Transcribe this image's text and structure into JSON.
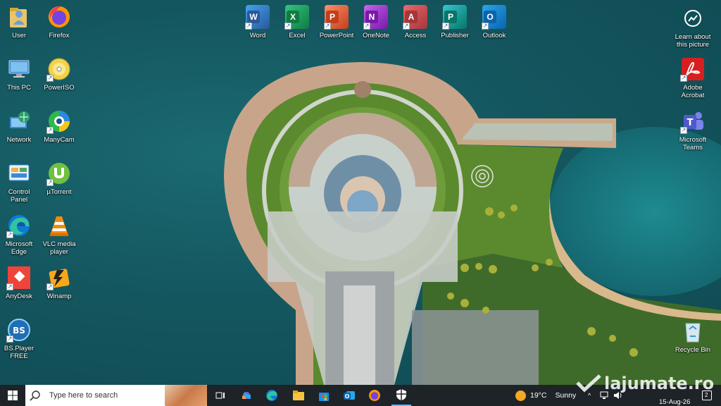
{
  "desktop": {
    "icons_left": [
      {
        "label": "User",
        "icon": "user-folder-icon"
      },
      {
        "label": "This PC",
        "icon": "this-pc-icon"
      },
      {
        "label": "Network",
        "icon": "network-icon"
      },
      {
        "label": "Control\nPanel",
        "icon": "control-panel-icon"
      },
      {
        "label": "Microsoft\nEdge",
        "icon": "edge-icon"
      },
      {
        "label": "AnyDesk",
        "icon": "anydesk-icon"
      },
      {
        "label": "BS.Player\nFREE",
        "icon": "bsplayer-icon"
      },
      {
        "label": "Firefox",
        "icon": "firefox-icon"
      },
      {
        "label": "PowerISO",
        "icon": "poweriso-icon"
      },
      {
        "label": "ManyCam",
        "icon": "manycam-icon"
      },
      {
        "label": "µTorrent",
        "icon": "utorrent-icon"
      },
      {
        "label": "VLC media\nplayer",
        "icon": "vlc-icon"
      },
      {
        "label": "Winamp",
        "icon": "winamp-icon"
      }
    ],
    "office_icons": [
      {
        "label": "Word",
        "letter": "W",
        "color": "#2b579a",
        "light": "#41a5ee"
      },
      {
        "label": "Excel",
        "letter": "X",
        "color": "#107c41",
        "light": "#33c481"
      },
      {
        "label": "PowerPoint",
        "letter": "P",
        "color": "#c43e1c",
        "light": "#ff8f6b"
      },
      {
        "label": "OneNote",
        "letter": "N",
        "color": "#7719aa",
        "light": "#ca64ea"
      },
      {
        "label": "Access",
        "letter": "A",
        "color": "#a4373a",
        "light": "#ee686b"
      },
      {
        "label": "Publisher",
        "letter": "P",
        "color": "#077568",
        "light": "#37c6d0"
      },
      {
        "label": "Outlook",
        "letter": "O",
        "color": "#0a64ad",
        "light": "#28a8ea"
      }
    ],
    "icons_right": [
      {
        "label": "Learn about\nthis picture",
        "icon": "learn-picture-icon"
      },
      {
        "label": "Adobe\nAcrobat",
        "icon": "acrobat-icon"
      },
      {
        "label": "Microsoft\nTeams",
        "icon": "teams-icon"
      },
      {
        "label": "Recycle Bin",
        "icon": "recycle-bin-icon"
      }
    ]
  },
  "taskbar": {
    "search_placeholder": "Type here to search",
    "weather_temp": "19°C",
    "weather_cond": "Sunny",
    "date": "15-Aug-26",
    "notification_count": "2",
    "watermark": "lajumate.ro"
  },
  "colors": {
    "taskbar": "#1d2327",
    "water": "#14565f",
    "grass": "#5b8a2e"
  }
}
